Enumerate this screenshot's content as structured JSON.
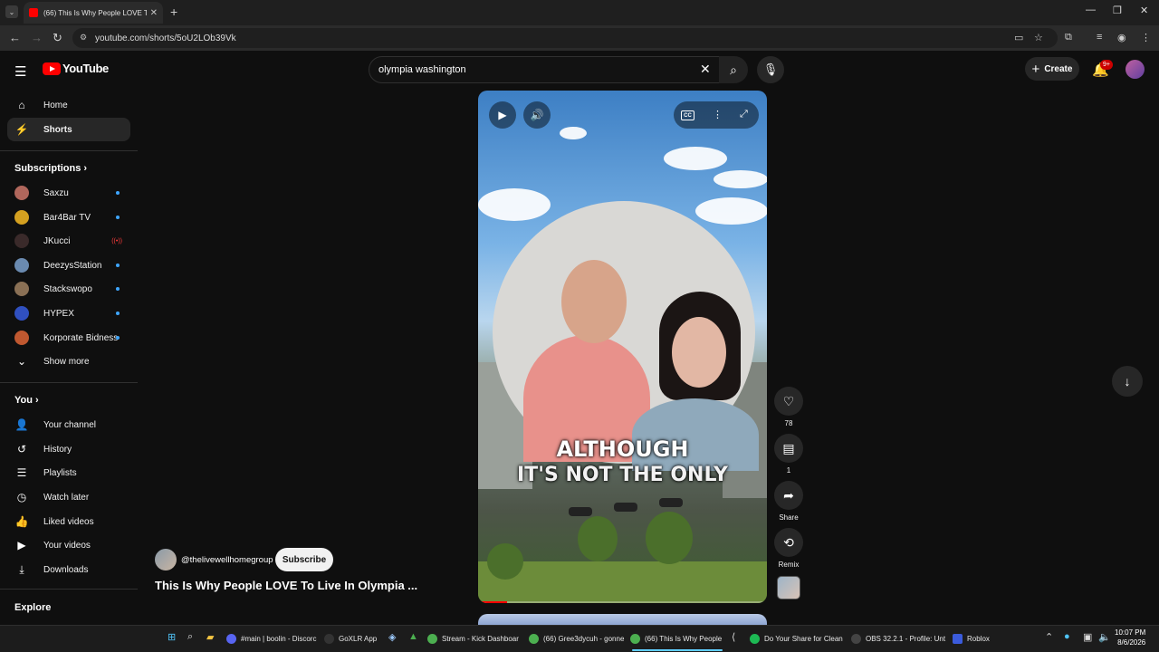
{
  "browser": {
    "tab_title": "(66) This Is Why People LOVE To",
    "url": "youtube.com/shorts/5oU2LOb39Vk"
  },
  "header": {
    "logo_text": "YouTube",
    "search_value": "olympia washington",
    "create_label": "Create",
    "notification_badge": "9+"
  },
  "sidebar": {
    "main_items": [
      {
        "label": "Home",
        "icon": "home-icon"
      },
      {
        "label": "Shorts",
        "icon": "shorts-icon",
        "active": true
      }
    ],
    "subscriptions_heading": "Subscriptions",
    "subscriptions": [
      {
        "label": "Saxzu",
        "color": "#b0675c"
      },
      {
        "label": "Bar4Bar TV",
        "color": "#d4a020"
      },
      {
        "label": "JKucci",
        "color": "#3a2a2a",
        "live": true
      },
      {
        "label": "DeezysStation",
        "color": "#6a8ab0"
      },
      {
        "label": "Stackswopo",
        "color": "#8a7055"
      },
      {
        "label": "HYPEX",
        "color": "#3050c0"
      },
      {
        "label": "Korporate Bidness",
        "color": "#c05830"
      }
    ],
    "show_more": "Show more",
    "you_heading": "You",
    "you_items": [
      {
        "label": "Your channel",
        "icon": "channel-icon"
      },
      {
        "label": "History",
        "icon": "history-icon"
      },
      {
        "label": "Playlists",
        "icon": "playlists-icon"
      },
      {
        "label": "Watch later",
        "icon": "clock-icon"
      },
      {
        "label": "Liked videos",
        "icon": "thumbs-up-icon"
      },
      {
        "label": "Your videos",
        "icon": "video-icon"
      },
      {
        "label": "Downloads",
        "icon": "download-icon"
      }
    ],
    "explore_heading": "Explore"
  },
  "video": {
    "caption_line1": "ALTHOUGH",
    "caption_line2": "IT'S NOT THE ONLY",
    "progress": 0.1
  },
  "actions": {
    "likes": "78",
    "comments": "1",
    "share": "Share",
    "remix": "Remix"
  },
  "channel": {
    "handle": "@thelivewellhomegroup",
    "subscribe_label": "Subscribe",
    "title": "This Is Why People LOVE To Live In Olympia ..."
  },
  "taskbar": {
    "items": [
      {
        "label": "#main | boolin - Discorc",
        "color": "#5865f2"
      },
      {
        "label": "GoXLR App",
        "color": "#333333"
      },
      {
        "label": "Stream - Kick Dashboar",
        "color": "#4caf50"
      },
      {
        "label": "(66) Gree3dycuh - gonne",
        "color": "#4caf50"
      },
      {
        "label": "(66) This Is Why People",
        "color": "#4caf50"
      },
      {
        "label": "Do Your Share for Clean",
        "color": "#1db954"
      },
      {
        "label": "OBS 32.2.1 - Profile: Unt",
        "color": "#444444"
      },
      {
        "label": "Roblox",
        "color": "#3b5bdb"
      }
    ],
    "time": "10:07 PM",
    "date": "8/6/2026"
  }
}
